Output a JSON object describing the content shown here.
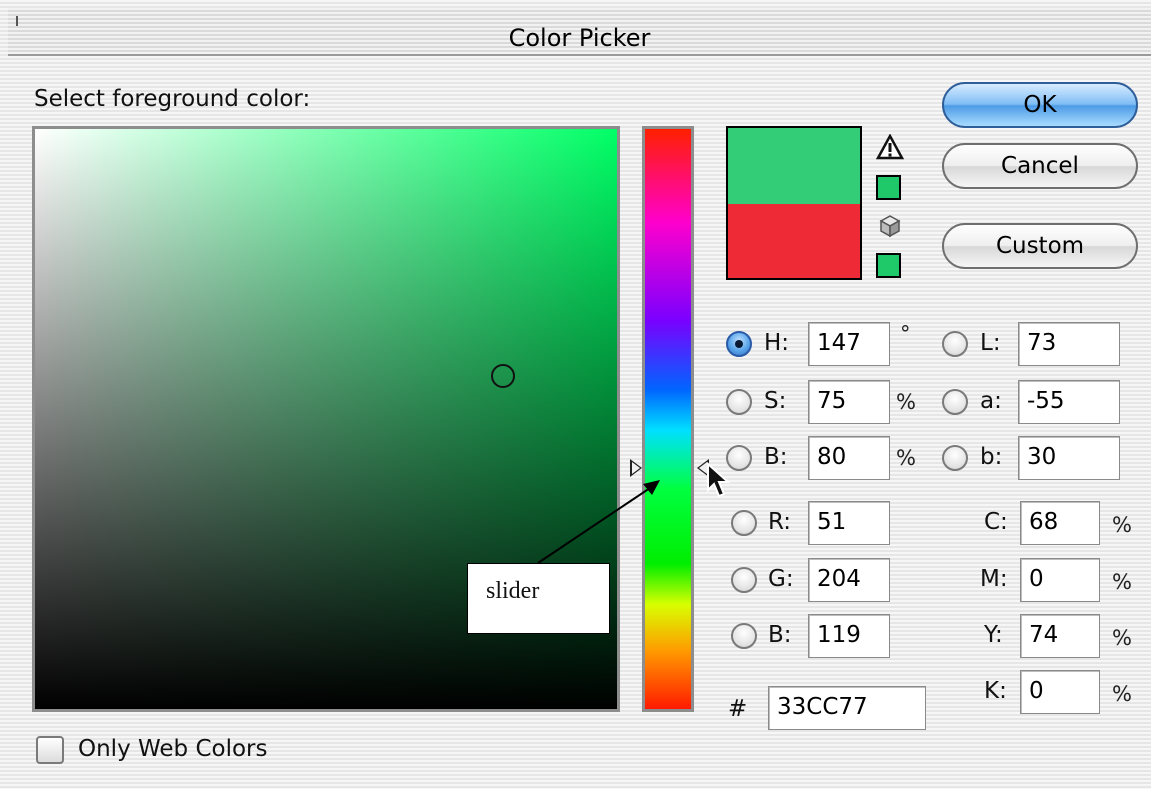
{
  "window": {
    "title": "Color Picker"
  },
  "prompt": "Select foreground color:",
  "buttons": {
    "ok": "OK",
    "cancel": "Cancel",
    "custom": "Custom"
  },
  "colors": {
    "new_color": "#33cc77",
    "previous_color": "#ed2a35",
    "accent": "#4d9be6"
  },
  "hsb": {
    "h": {
      "label": "H:",
      "value": "147",
      "unit": "°",
      "selected": true
    },
    "s": {
      "label": "S:",
      "value": "75",
      "unit": "%"
    },
    "b": {
      "label": "B:",
      "value": "80",
      "unit": "%"
    }
  },
  "rgb": {
    "r": {
      "label": "R:",
      "value": "51"
    },
    "g": {
      "label": "G:",
      "value": "204"
    },
    "b": {
      "label": "B:",
      "value": "119"
    }
  },
  "lab": {
    "l": {
      "label": "L:",
      "value": "73"
    },
    "a": {
      "label": "a:",
      "value": "-55"
    },
    "b": {
      "label": "b:",
      "value": "30"
    }
  },
  "cmyk": {
    "c": {
      "label": "C:",
      "value": "68",
      "unit": "%"
    },
    "m": {
      "label": "M:",
      "value": "0",
      "unit": "%"
    },
    "y": {
      "label": "Y:",
      "value": "74",
      "unit": "%"
    },
    "k": {
      "label": "K:",
      "value": "0",
      "unit": "%"
    }
  },
  "hex": {
    "label": "#",
    "value": "33CC77"
  },
  "web_colors": {
    "label": "Only Web Colors",
    "checked": false
  },
  "annotation": {
    "text": "slider"
  },
  "icons": [
    "warning-icon",
    "cube-icon",
    "mouse-pointer-icon"
  ]
}
